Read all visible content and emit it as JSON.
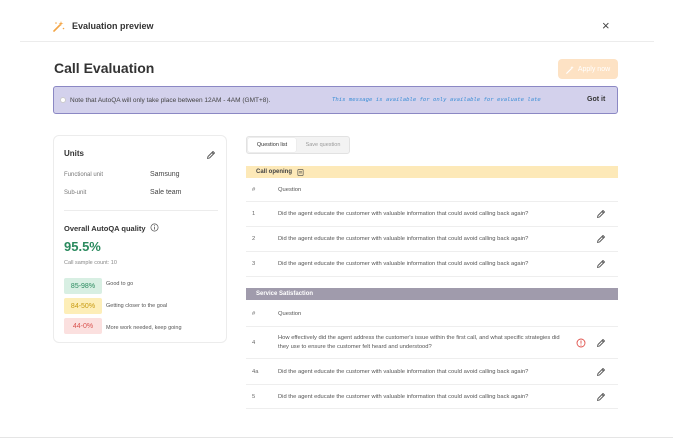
{
  "header": {
    "title": "Evaluation preview",
    "close": "×"
  },
  "page_title": "Call Evaluation",
  "apply_button": "Apply now",
  "notice": {
    "text": "Note that AutoQA will only take place between 12AM - 4AM (GMT+8).",
    "mono": "This message is available for only available for evaluate late",
    "action": "Got it"
  },
  "units": {
    "title": "Units",
    "functional_label": "Functional unit",
    "functional_value": "Samsung",
    "subunit_label": "Sub-unit",
    "subunit_value": "Sale team"
  },
  "autoqa": {
    "title": "Overall AutoQA quality",
    "value": "95.5%",
    "sample_count": "Call sample count: 10",
    "legend": [
      {
        "range": "85-98%",
        "label": "Good to go"
      },
      {
        "range": "84-50%",
        "label": "Getting closer to the goal"
      },
      {
        "range": "44-0%",
        "label": "More work needed, keep going"
      }
    ]
  },
  "tabs": {
    "active": "Question list",
    "idle": "Save question"
  },
  "sections": {
    "opening": {
      "title": "Call opening",
      "header_num": "#",
      "header_q": "Question",
      "rows": [
        {
          "num": "1",
          "q": "Did the agent educate the customer with valuable information that could avoid calling back again?"
        },
        {
          "num": "2",
          "q": "Did the agent educate the customer with valuable information that could avoid calling back again?"
        },
        {
          "num": "3",
          "q": "Did the agent educate the customer with valuable information that could avoid calling back again?"
        }
      ]
    },
    "service": {
      "title": "Service Satisfaction",
      "header_num": "#",
      "header_q": "Question",
      "rows": [
        {
          "num": "4",
          "q": "How effectively did the agent address the customer's issue within the first call, and what specific strategies did they use to ensure the customer felt heard and understood?"
        },
        {
          "num": "4a",
          "q": "Did the agent educate the customer with valuable information that could avoid calling back again?"
        },
        {
          "num": "5",
          "q": "Did the agent educate the customer with valuable information that could avoid calling back again?"
        }
      ]
    }
  },
  "colors": {
    "accent_orange": "#f3a545",
    "notice_bg": "#d3d1ec",
    "good": "#2a8a5e",
    "mid": "#c79a10",
    "bad": "#d9534f"
  }
}
